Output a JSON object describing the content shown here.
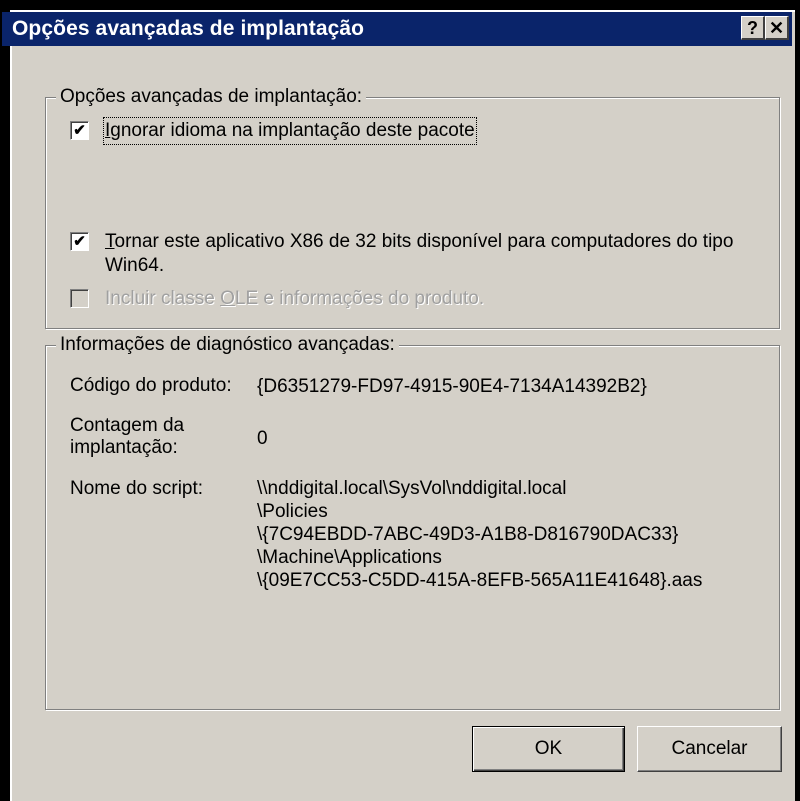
{
  "window": {
    "title": "Opções avançadas de implantação",
    "help_button": "?",
    "close_button": "✕"
  },
  "advanced_options": {
    "legend": "Opções avançadas de implantação:",
    "ignore_language": {
      "checked": true,
      "mnemonic": "I",
      "label_rest": "gnorar idioma na implantação deste pacote"
    },
    "make_x86_available": {
      "checked": true,
      "mnemonic": "T",
      "label_rest": "ornar este aplicativo X86 de 32 bits disponível para computadores do tipo Win64."
    },
    "include_ole": {
      "checked": false,
      "enabled": false,
      "label_before": "Incluir classe ",
      "mnemonic": "O",
      "label_after": "LE e informações do produto."
    }
  },
  "diagnostics": {
    "legend": "Informações de diagnóstico avançadas:",
    "product_code_label": "Código do produto:",
    "product_code_value": "{D6351279-FD97-4915-90E4-7134A14392B2}",
    "deploy_count_label_line1": "Contagem da",
    "deploy_count_label_line2": "implantação:",
    "deploy_count_value": "0",
    "script_name_label": "Nome do script:",
    "script_name_lines": [
      "\\\\nddigital.local\\SysVol\\nddigital.local",
      "\\Policies",
      "\\{7C94EBDD-7ABC-49D3-A1B8-D816790DAC33}",
      "\\Machine\\Applications",
      "\\{09E7CC53-C5DD-415A-8EFB-565A11E41648}.aas"
    ]
  },
  "buttons": {
    "ok_label": "OK",
    "cancel_label": "Cancelar"
  },
  "colors": {
    "titlebar": "#0a246a",
    "dialog_face": "#d4d0c8"
  }
}
